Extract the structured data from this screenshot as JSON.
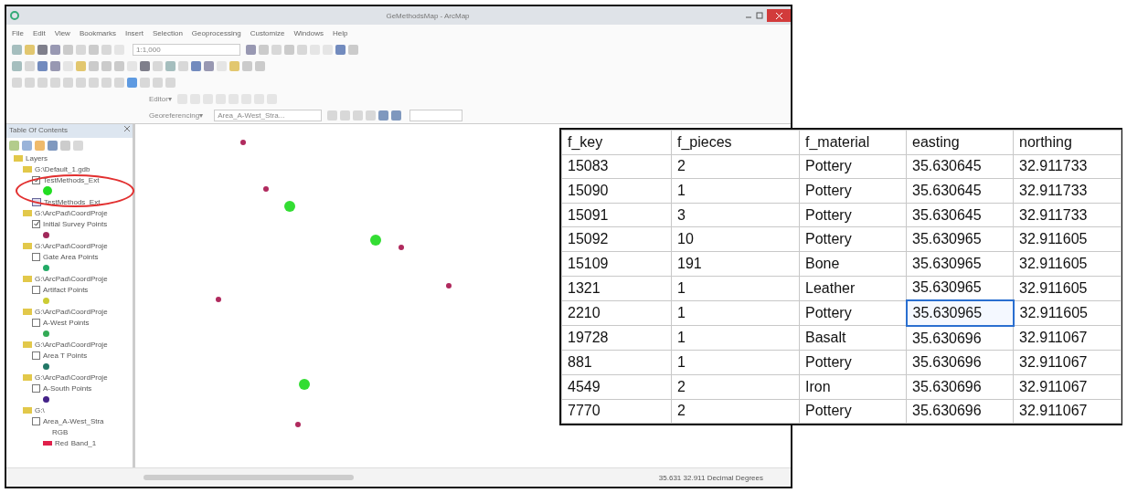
{
  "window": {
    "title": "GeMethodsMap - ArcMap"
  },
  "menu": [
    "File",
    "Edit",
    "View",
    "Bookmarks",
    "Insert",
    "Selection",
    "Geoprocessing",
    "Customize",
    "Windows",
    "Help"
  ],
  "toolbar": {
    "scale": "1:1,000",
    "editor": "Editor▾",
    "geo_layer": "Georeferencing▾",
    "raster": "Area_A-West_Stra..."
  },
  "toc": {
    "title": "Table Of Contents",
    "root": "Layers",
    "children": [
      {
        "kind": "group",
        "label": "G:\\Default_1.gdb",
        "children": [
          {
            "kind": "layer",
            "label": "TestMethods_Ext",
            "checked": true,
            "color": "#22dd22"
          },
          {
            "kind": "table",
            "label": "TestMethods_Ext"
          }
        ]
      },
      {
        "kind": "group",
        "label": "G:\\ArcPad\\CoordProje",
        "children": [
          {
            "kind": "layer",
            "label": "Initial Survey Points",
            "checked": true,
            "color": "#a0285a"
          }
        ]
      },
      {
        "kind": "group",
        "label": "G:\\ArcPad\\CoordProje",
        "children": [
          {
            "kind": "layer",
            "label": "Gate Area Points",
            "checked": false,
            "color": "#22aa66"
          }
        ]
      },
      {
        "kind": "group",
        "label": "G:\\ArcPad\\CoordProje",
        "children": [
          {
            "kind": "layer",
            "label": "Artifact Points",
            "checked": false,
            "color": "#cccc33"
          }
        ]
      },
      {
        "kind": "group",
        "label": "G:\\ArcPad\\CoordProje",
        "children": [
          {
            "kind": "layer",
            "label": "A-West Points",
            "checked": false,
            "color": "#33aa55"
          }
        ]
      },
      {
        "kind": "group",
        "label": "G:\\ArcPad\\CoordProje",
        "children": [
          {
            "kind": "layer",
            "label": "Area T Points",
            "checked": false,
            "color": "#227766"
          }
        ]
      },
      {
        "kind": "group",
        "label": "G:\\ArcPad\\CoordProje",
        "children": [
          {
            "kind": "layer",
            "label": "A-South Points",
            "checked": false,
            "color": "#442288"
          }
        ]
      },
      {
        "kind": "group",
        "label": "G:\\",
        "children": [
          {
            "kind": "raster",
            "label": "Area_A-West_Stra",
            "checked": false,
            "legend": "RGB",
            "band": "Red",
            "band_value": "Band_1",
            "color": "#e0204a"
          }
        ]
      }
    ]
  },
  "status_bar": {
    "coordinates": "35.631 32.911 Decimal Degrees"
  },
  "table": {
    "columns": [
      "f_key",
      "f_pieces",
      "f_material",
      "easting",
      "northing"
    ],
    "rows": [
      {
        "cells": [
          {
            "text": "15083",
            "selected": false
          },
          {
            "text": "2",
            "selected": false
          },
          {
            "text": "Pottery",
            "selected": false
          },
          {
            "text": "35.630645",
            "selected": false
          },
          {
            "text": "32.911733",
            "selected": false
          }
        ]
      },
      {
        "cells": [
          {
            "text": "15090",
            "selected": false
          },
          {
            "text": "1",
            "selected": false
          },
          {
            "text": "Pottery",
            "selected": false
          },
          {
            "text": "35.630645",
            "selected": false
          },
          {
            "text": "32.911733",
            "selected": false
          }
        ]
      },
      {
        "cells": [
          {
            "text": "15091",
            "selected": false
          },
          {
            "text": "3",
            "selected": false
          },
          {
            "text": "Pottery",
            "selected": false
          },
          {
            "text": "35.630645",
            "selected": false
          },
          {
            "text": "32.911733",
            "selected": false
          }
        ]
      },
      {
        "cells": [
          {
            "text": "15092",
            "selected": false
          },
          {
            "text": "10",
            "selected": false
          },
          {
            "text": "Pottery",
            "selected": false
          },
          {
            "text": "35.630965",
            "selected": false
          },
          {
            "text": "32.911605",
            "selected": false
          }
        ]
      },
      {
        "cells": [
          {
            "text": "15109",
            "selected": false
          },
          {
            "text": "191",
            "selected": false
          },
          {
            "text": "Bone",
            "selected": false
          },
          {
            "text": "35.630965",
            "selected": false
          },
          {
            "text": "32.911605",
            "selected": false
          }
        ]
      },
      {
        "cells": [
          {
            "text": "1321",
            "selected": false
          },
          {
            "text": "1",
            "selected": false
          },
          {
            "text": "Leather",
            "selected": false
          },
          {
            "text": "35.630965",
            "selected": false
          },
          {
            "text": "32.911605",
            "selected": false
          }
        ]
      },
      {
        "cells": [
          {
            "text": "2210",
            "selected": false
          },
          {
            "text": "1",
            "selected": false
          },
          {
            "text": "Pottery",
            "selected": false
          },
          {
            "text": "35.630965",
            "selected": true
          },
          {
            "text": "32.911605",
            "selected": false
          }
        ]
      },
      {
        "cells": [
          {
            "text": "19728",
            "selected": false
          },
          {
            "text": "1",
            "selected": false
          },
          {
            "text": "Basalt",
            "selected": false
          },
          {
            "text": "35.630696",
            "selected": false
          },
          {
            "text": "32.911067",
            "selected": false
          }
        ]
      },
      {
        "cells": [
          {
            "text": "881",
            "selected": false
          },
          {
            "text": "1",
            "selected": false
          },
          {
            "text": "Pottery",
            "selected": false
          },
          {
            "text": "35.630696",
            "selected": false
          },
          {
            "text": "32.911067",
            "selected": false
          }
        ]
      },
      {
        "cells": [
          {
            "text": "4549",
            "selected": false
          },
          {
            "text": "2",
            "selected": false
          },
          {
            "text": "Iron",
            "selected": false
          },
          {
            "text": "35.630696",
            "selected": false
          },
          {
            "text": "32.911067",
            "selected": false
          }
        ]
      },
      {
        "cells": [
          {
            "text": "7770",
            "selected": false
          },
          {
            "text": "2",
            "selected": false
          },
          {
            "text": "Pottery",
            "selected": false
          },
          {
            "text": "35.630696",
            "selected": false
          },
          {
            "text": "32.911067",
            "selected": false
          }
        ]
      }
    ]
  }
}
